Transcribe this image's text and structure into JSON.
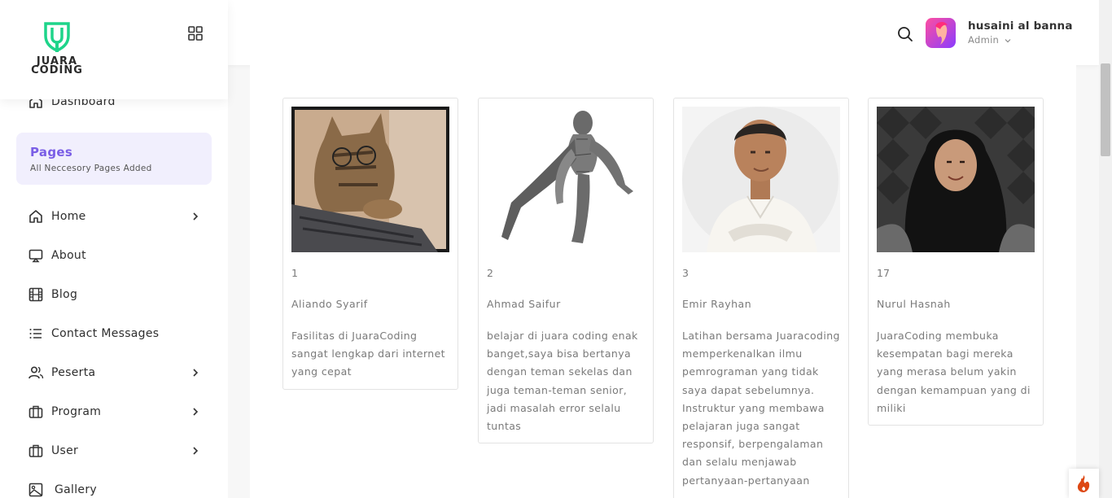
{
  "brand": {
    "line1": "JUARA",
    "line2": "CODING"
  },
  "sidebar": {
    "dashboard": "Dashboard",
    "pages_title": "Pages",
    "pages_subtitle": "All Neccesory Pages Added",
    "items": [
      {
        "label": "Home",
        "icon": "home-icon",
        "has_chevron": true
      },
      {
        "label": "About",
        "icon": "monitor-icon",
        "has_chevron": false
      },
      {
        "label": "Blog",
        "icon": "film-icon",
        "has_chevron": false
      },
      {
        "label": "Contact Messages",
        "icon": "list-icon",
        "has_chevron": false
      },
      {
        "label": "Peserta",
        "icon": "users-icon",
        "has_chevron": true
      },
      {
        "label": "Program",
        "icon": "briefcase-icon",
        "has_chevron": true
      },
      {
        "label": "User",
        "icon": "briefcase-icon",
        "has_chevron": true
      },
      {
        "label": "Gallery",
        "icon": "image-icon",
        "has_chevron": false
      }
    ]
  },
  "header": {
    "user_name": "husaini al banna",
    "user_role": "Admin"
  },
  "testimonials": [
    {
      "number": "1",
      "name": "Aliando Syarif",
      "message": "Fasilitas di JuaraCoding sangat lengkap dari internet yang cepat"
    },
    {
      "number": "2",
      "name": "Ahmad Saifur",
      "message": "belajar di juara coding enak banget,saya bisa bertanya dengan teman sekelas dan juga teman-teman senior, jadi masalah error selalu tuntas"
    },
    {
      "number": "3",
      "name": "Emir Rayhan",
      "message": "Latihan bersama Juaracoding memperkenalkan ilmu pemrograman yang tidak saya dapat sebelumnya. Instruktur yang membawa pelajaran juga sangat responsif, berpengalaman dan selalu menjawab pertanyaan-pertanyaan"
    },
    {
      "number": "17",
      "name": "Nurul Hasnah",
      "message": "JuaraCoding membuka kesempatan bagi mereka yang merasa belum yakin dengan kemampuan yang di miliki"
    }
  ],
  "colors": {
    "accent": "#7a5ee6",
    "logo_green": "#1ed48a"
  }
}
